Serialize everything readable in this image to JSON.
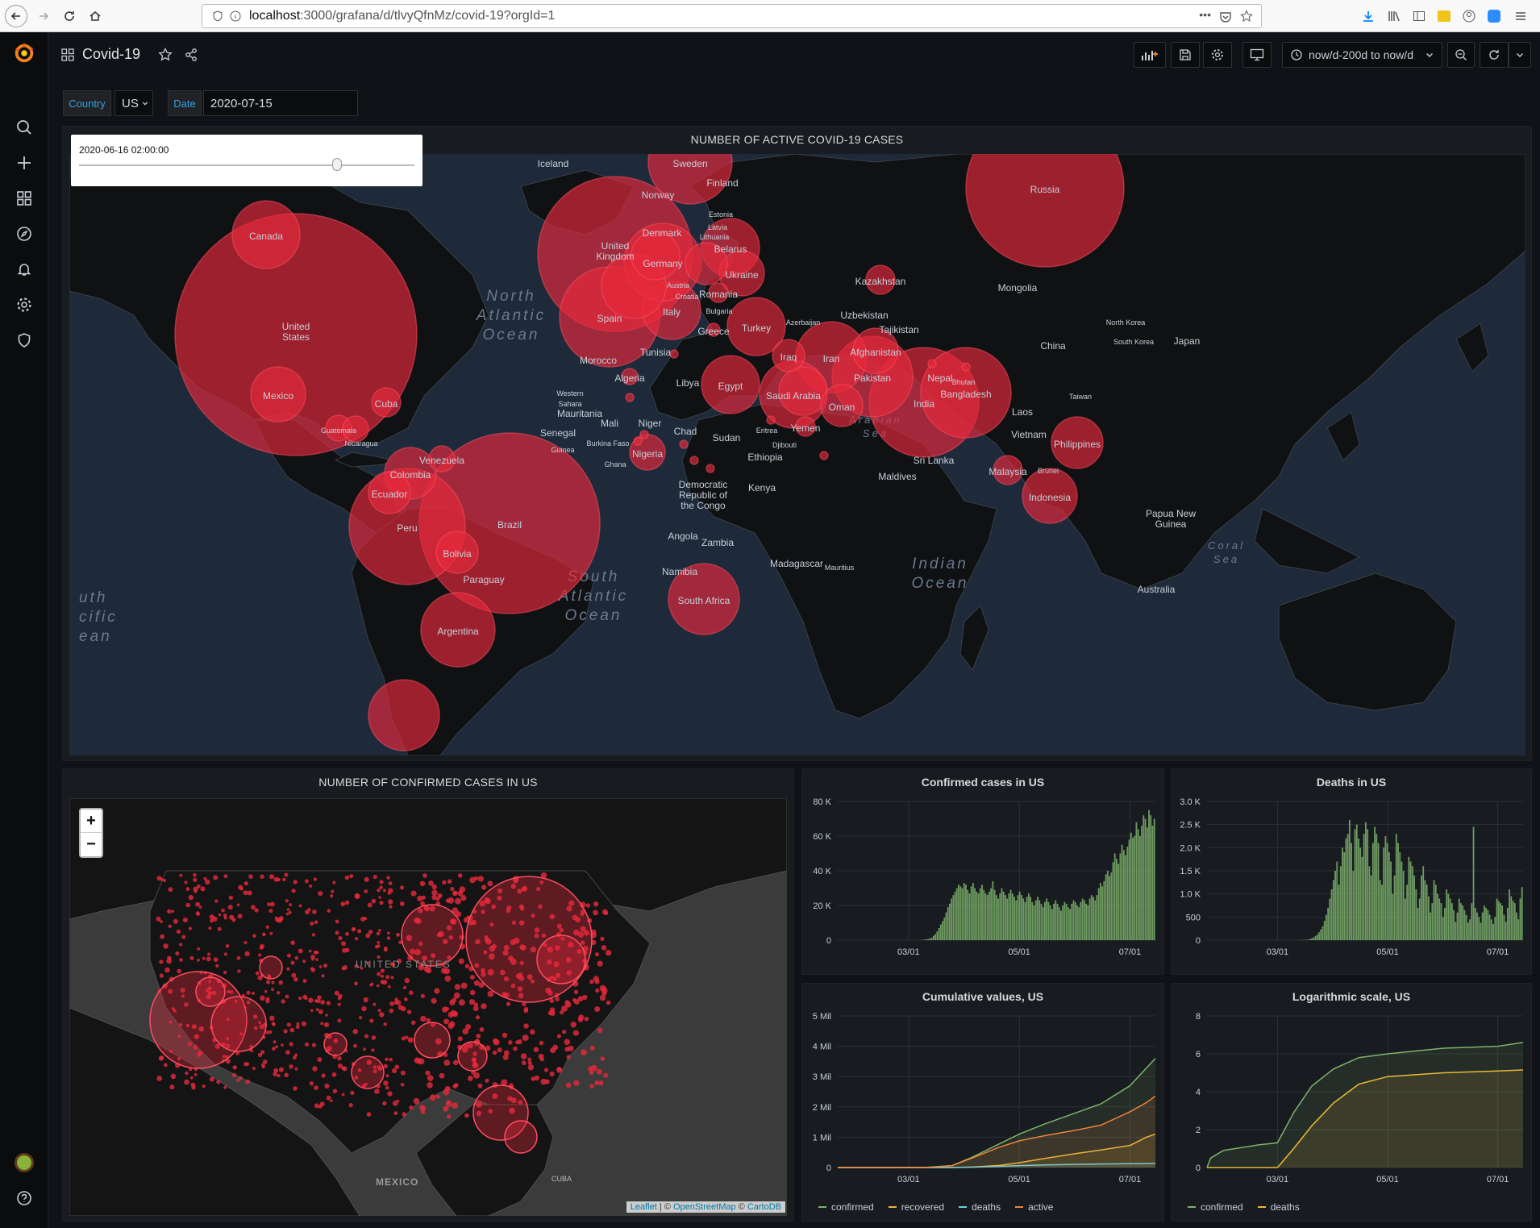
{
  "browser": {
    "url_host": "localhost",
    "url_rest": ":3000/grafana/d/tlvyQfnMz/covid-19?orgId=1",
    "more_icon": "•••"
  },
  "header": {
    "dashboard_title": "Covid-19",
    "time_range": "now/d-200d to now/d"
  },
  "variables": {
    "country_label": "Country",
    "country_value": "US",
    "date_label": "Date",
    "date_value": "2020-07-15"
  },
  "world_panel": {
    "title": "NUMBER OF ACTIVE COVID-19 CASES",
    "slider_time": "2020-06-16 02:00:00",
    "slider_position": 0.77,
    "labels": [
      "Iceland",
      "Sweden",
      "Finland",
      "Norway",
      "Estonia",
      "Latvia",
      "Denmark",
      "Lithuania",
      "Belarus",
      "United Kingdom",
      "Germany",
      "Ukraine",
      "Austria",
      "Croatia",
      "Romania",
      "Bulgaria",
      "Spain",
      "Italy",
      "Greece",
      "Turkey",
      "Azerbaijan",
      "Kazakhstan",
      "Mongolia",
      "Uzbekistan",
      "Tajikistan",
      "North Korea",
      "South Korea",
      "Japan",
      "China",
      "Russia",
      "Canada",
      "United States",
      "Mexico",
      "Cuba",
      "Guatemala",
      "Nicaragua",
      "Venezuela",
      "Colombia",
      "Ecuador",
      "Peru",
      "Brazil",
      "Bolivia",
      "Paraguay",
      "Argentina",
      "Morocco",
      "Tunisia",
      "Algeria",
      "Libya",
      "Egypt",
      "Iraq",
      "Iran",
      "Afghanistan",
      "Pakistan",
      "Nepal",
      "Bhutan",
      "Bangladesh",
      "India",
      "Saudi Arabia",
      "Oman",
      "Yemen",
      "Western Sahara",
      "Mauritania",
      "Mali",
      "Niger",
      "Chad",
      "Sudan",
      "Eritrea",
      "Djibouti",
      "Ethiopia",
      "Senegal",
      "Guinea",
      "Burkina Faso",
      "Ghana",
      "Nigeria",
      "Democratic Republic of the Congo",
      "Kenya",
      "Angola",
      "Zambia",
      "Namibia",
      "South Africa",
      "Madagascar",
      "Mauritius",
      "Maldives",
      "Sri Lanka",
      "Laos",
      "Vietnam",
      "Taiwan",
      "Philippines",
      "Malaysia",
      "Brunei",
      "Indonesia",
      "Papua New Guinea",
      "Australia"
    ],
    "ocean_labels": [
      "North Atlantic Ocean",
      "South Atlantic Ocean",
      "Indian Ocean",
      "Arabian Sea",
      "Coral Sea",
      "uth cific ean"
    ]
  },
  "us_map_panel": {
    "title": "NUMBER OF CONFIRMED CASES IN US",
    "zoom_in": "+",
    "zoom_out": "−",
    "country_label": "UNITED STATES",
    "mexico_label": "MEXICO",
    "cuba_label": "CUBA",
    "attribution_leaflet": "Leaflet",
    "attribution_sep1": " | © ",
    "attribution_osm": "OpenStreetMap",
    "attribution_sep2": " © ",
    "attribution_carto": "CartoDB"
  },
  "charts": {
    "colors": {
      "confirmed": "#7eb26d",
      "recovered": "#eab839",
      "deaths": "#6ed0e0",
      "active": "#ef843c",
      "grid": "#2c3235",
      "axis_text": "#c7d0d9"
    },
    "x_ticks": [
      "03/01",
      "05/01",
      "07/01"
    ]
  },
  "chart_data": [
    {
      "type": "bar",
      "title": "Confirmed cases in US",
      "y_ticks": [
        "80 K",
        "60 K",
        "40 K",
        "20 K",
        "0"
      ],
      "ylim": [
        0,
        80000
      ],
      "x_range": [
        "2020-01-22",
        "2020-07-15"
      ],
      "x_ticks": [
        "03/01",
        "05/01",
        "07/01"
      ],
      "series": [
        {
          "values": [
            0,
            0,
            0,
            0,
            0,
            0,
            0,
            0,
            0,
            0,
            0,
            0,
            0,
            0,
            0,
            0,
            0,
            0,
            0,
            0,
            0,
            0,
            0,
            0,
            0,
            0,
            0,
            0,
            0,
            0,
            0,
            0,
            0,
            0,
            0,
            0,
            0,
            0,
            0,
            0,
            0,
            0,
            0,
            0,
            0,
            50,
            100,
            200,
            300,
            500,
            700,
            1000,
            1500,
            2500,
            3500,
            5000,
            7000,
            9000,
            11000,
            13000,
            16000,
            19000,
            21000,
            24000,
            26000,
            28000,
            30000,
            32000,
            31000,
            30000,
            33000,
            32000,
            29000,
            27000,
            31000,
            33000,
            30000,
            28000,
            27000,
            30000,
            32000,
            29000,
            27000,
            26000,
            28000,
            30000,
            34000,
            29000,
            26000,
            24000,
            27000,
            30000,
            28000,
            26000,
            24000,
            27000,
            29000,
            27000,
            25000,
            23000,
            26000,
            28000,
            26000,
            24000,
            22000,
            25000,
            27000,
            25000,
            22000,
            20000,
            23000,
            25000,
            23000,
            21000,
            19000,
            22000,
            24000,
            22000,
            20000,
            18000,
            21000,
            23000,
            21000,
            19000,
            17000,
            20000,
            22000,
            21000,
            19000,
            18000,
            21000,
            23000,
            22000,
            20000,
            19000,
            22000,
            24000,
            23000,
            21000,
            20000,
            24000,
            26000,
            25000,
            23000,
            26000,
            30000,
            33000,
            31000,
            34000,
            38000,
            40000,
            37000,
            39000,
            45000,
            50000,
            47000,
            44000,
            50000,
            55000,
            52000,
            49000,
            54000,
            58000,
            62000,
            59000,
            60000,
            68000,
            64000,
            60000,
            66000,
            72000,
            70000,
            65000,
            75000,
            72000,
            66000,
            70000
          ]
        }
      ]
    },
    {
      "type": "bar",
      "title": "Deaths in US",
      "y_ticks": [
        "3.0 K",
        "2.5 K",
        "2.0 K",
        "1.5 K",
        "1.0 K",
        "500",
        "0"
      ],
      "ylim": [
        0,
        3000
      ],
      "x_range": [
        "2020-01-22",
        "2020-07-15"
      ],
      "x_ticks": [
        "03/01",
        "05/01",
        "07/01"
      ],
      "series": [
        {
          "values": [
            0,
            0,
            0,
            0,
            0,
            0,
            0,
            0,
            0,
            0,
            0,
            0,
            0,
            0,
            0,
            0,
            0,
            0,
            0,
            0,
            0,
            0,
            0,
            0,
            0,
            0,
            0,
            0,
            0,
            0,
            0,
            0,
            0,
            0,
            0,
            0,
            0,
            0,
            0,
            0,
            0,
            0,
            0,
            0,
            0,
            0,
            0,
            0,
            0,
            0,
            0,
            0,
            2,
            4,
            6,
            10,
            15,
            25,
            40,
            60,
            90,
            120,
            170,
            230,
            300,
            420,
            550,
            700,
            900,
            1100,
            1300,
            1500,
            1700,
            1200,
            1600,
            2000,
            1900,
            2200,
            2300,
            2600,
            2100,
            1500,
            2400,
            2500,
            2200,
            2000,
            1800,
            2300,
            2550,
            2400,
            1600,
            1400,
            2100,
            2450,
            2300,
            2100,
            1300,
            1200,
            2000,
            2250,
            2100,
            1900,
            1700,
            1000,
            1400,
            2300,
            2100,
            1900,
            1700,
            1500,
            900,
            1200,
            1800,
            1700,
            1600,
            1400,
            1100,
            700,
            900,
            1400,
            1600,
            1300,
            1200,
            950,
            600,
            800,
            1300,
            1200,
            1000,
            900,
            800,
            500,
            700,
            1100,
            1000,
            900,
            800,
            650,
            400,
            600,
            900,
            800,
            750,
            650,
            550,
            380,
            450,
            800,
            2450,
            700,
            600,
            500,
            380,
            600,
            750,
            700,
            650,
            550,
            450,
            350,
            500,
            900,
            850,
            800,
            750,
            550,
            400,
            700,
            1100,
            950,
            850,
            800,
            600,
            450,
            900,
            1150
          ]
        }
      ]
    },
    {
      "type": "area",
      "title": "Cumulative values, US",
      "y_ticks": [
        "5 Mil",
        "4 Mil",
        "3 Mil",
        "2 Mil",
        "1 Mil",
        "0"
      ],
      "ylim": [
        0,
        5000000
      ],
      "x_range": [
        "2020-01-22",
        "2020-07-15"
      ],
      "x_ticks": [
        "03/01",
        "05/01",
        "07/01"
      ],
      "x": [
        "01/22",
        "02/20",
        "03/10",
        "03/25",
        "04/05",
        "04/20",
        "05/01",
        "05/15",
        "06/01",
        "06/15",
        "07/01",
        "07/10",
        "07/15"
      ],
      "series": [
        {
          "name": "confirmed",
          "values": [
            0,
            15,
            1000,
            65000,
            337000,
            780000,
            1100000,
            1440000,
            1800000,
            2100000,
            2700000,
            3280000,
            3600000
          ]
        },
        {
          "name": "recovered",
          "values": [
            0,
            5,
            100,
            500,
            17000,
            70000,
            160000,
            300000,
            460000,
            580000,
            730000,
            1000000,
            1100000
          ]
        },
        {
          "name": "deaths",
          "values": [
            0,
            0,
            30,
            1000,
            9500,
            40000,
            63000,
            85000,
            105000,
            116000,
            128000,
            134000,
            138000
          ]
        },
        {
          "name": "active",
          "values": [
            0,
            10,
            900,
            63000,
            310000,
            670000,
            880000,
            1050000,
            1230000,
            1400000,
            1840000,
            2140000,
            2360000
          ]
        }
      ]
    },
    {
      "type": "area",
      "title": "Logarithmic scale, US",
      "y_ticks": [
        "8",
        "6",
        "4",
        "2",
        "0"
      ],
      "ylim": [
        0,
        8
      ],
      "x_range": [
        "2020-01-22",
        "2020-07-15"
      ],
      "x_ticks": [
        "03/01",
        "05/01",
        "07/01"
      ],
      "x": [
        "01/22",
        "01/24",
        "01/31",
        "02/20",
        "03/01",
        "03/10",
        "03/20",
        "04/01",
        "04/15",
        "05/01",
        "06/01",
        "07/01",
        "07/15"
      ],
      "series": [
        {
          "name": "confirmed",
          "values": [
            0,
            0.5,
            0.9,
            1.2,
            1.3,
            2.9,
            4.3,
            5.2,
            5.8,
            6.0,
            6.3,
            6.4,
            6.6
          ]
        },
        {
          "name": "deaths",
          "values": [
            0,
            0,
            0,
            0,
            0,
            1.0,
            2.2,
            3.4,
            4.4,
            4.8,
            5.0,
            5.1,
            5.15
          ]
        }
      ]
    }
  ]
}
